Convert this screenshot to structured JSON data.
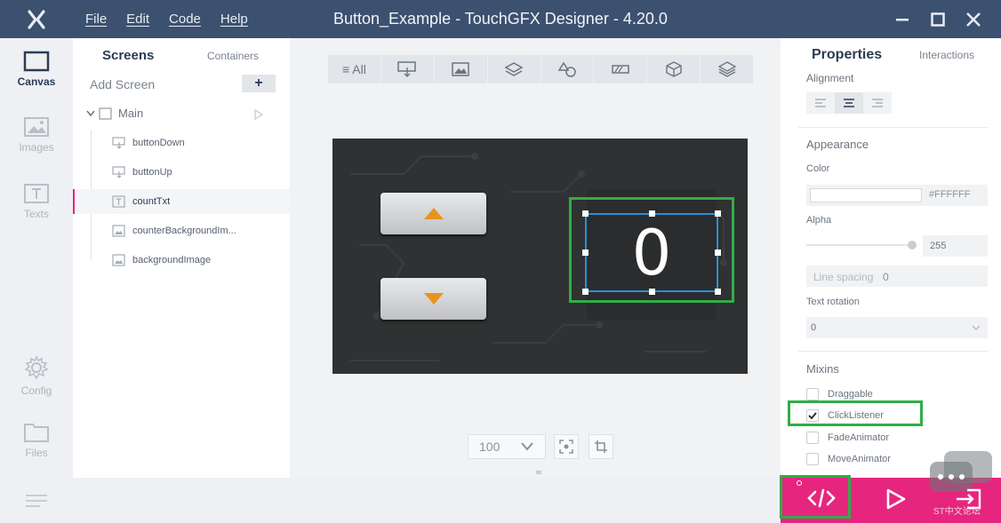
{
  "window": {
    "title": "Button_Example - TouchGFX Designer - 4.20.0",
    "menu": [
      "File",
      "Edit",
      "Code",
      "Help"
    ]
  },
  "rail": {
    "items": [
      {
        "label": "Canvas",
        "icon": "canvas-icon",
        "active": true
      },
      {
        "label": "Images",
        "icon": "images-icon",
        "active": false
      },
      {
        "label": "Texts",
        "icon": "texts-icon",
        "active": false
      },
      {
        "label": "Config",
        "icon": "gear-icon",
        "active": false
      },
      {
        "label": "Files",
        "icon": "folder-icon",
        "active": false
      }
    ]
  },
  "tree": {
    "tabs": [
      "Screens",
      "Containers"
    ],
    "add_screen_label": "Add Screen",
    "add_button_label": "+",
    "screen_name": "Main",
    "widgets": [
      {
        "name": "buttonDown",
        "icon": "button-widget-icon"
      },
      {
        "name": "buttonUp",
        "icon": "button-widget-icon"
      },
      {
        "name": "countTxt",
        "icon": "text-widget-icon",
        "selected": true
      },
      {
        "name": "counterBackgroundIm...",
        "icon": "image-widget-icon"
      },
      {
        "name": "backgroundImage",
        "icon": "image-widget-icon"
      }
    ]
  },
  "canvas": {
    "filter_all_label": "≡ All",
    "counter_value": "0",
    "zoom_value": "100"
  },
  "properties": {
    "tabs": [
      "Properties",
      "Interactions"
    ],
    "alignment_label": "Alignment",
    "appearance_label": "Appearance",
    "color_label": "Color",
    "color_value": "#FFFFFF",
    "alpha_label": "Alpha",
    "alpha_value": "255",
    "line_spacing_label": "Line spacing",
    "line_spacing_value": "0",
    "text_rotation_label": "Text rotation",
    "text_rotation_value": "0",
    "mixins_label": "Mixins",
    "mixins": [
      {
        "label": "Draggable",
        "checked": false
      },
      {
        "label": "ClickListener",
        "checked": true
      },
      {
        "label": "FadeAnimator",
        "checked": false
      },
      {
        "label": "MoveAnimator",
        "checked": false
      }
    ]
  },
  "watermark_text": "ST中文论坛",
  "colors": {
    "titlebar": "#3c5170",
    "accent_pink": "#e6267e",
    "highlight_green": "#2fae46",
    "selection_blue": "#2a8fd8",
    "arrow_orange": "#e8941c"
  }
}
